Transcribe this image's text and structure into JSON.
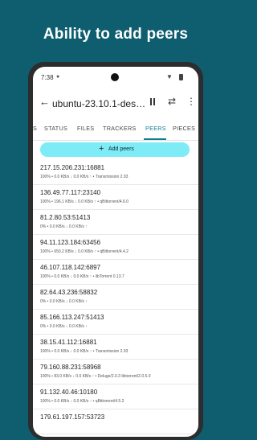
{
  "headline": "Ability to add peers",
  "status_bar": {
    "time": "7:38",
    "wifi_icon": "wifi-icon",
    "battery_icon": "battery-icon"
  },
  "toolbar": {
    "back_icon": "arrow-back-icon",
    "title": "ubuntu-23.10.1-des…",
    "pause_icon": "pause-icon",
    "sync_icon": "sync-icon",
    "more_icon": "more-vert-icon"
  },
  "tabs": [
    {
      "label": "S",
      "active": false
    },
    {
      "label": "STATUS",
      "active": false
    },
    {
      "label": "FILES",
      "active": false
    },
    {
      "label": "TRACKERS",
      "active": false
    },
    {
      "label": "PEERS",
      "active": true
    },
    {
      "label": "PIECES",
      "active": false
    }
  ],
  "add_button": {
    "label": "Add peers",
    "icon": "plus-icon"
  },
  "peers": [
    {
      "address": "217.15.206.231:16881",
      "progress": "100%",
      "down": "0.0 KB/s",
      "up": "0.0 KB/s",
      "client": "Transmission 2.93"
    },
    {
      "address": "136.49.77.117:23140",
      "progress": "100%",
      "down": "196.1 KB/s",
      "up": "0.0 KB/s",
      "client": "qBittorrent/4.6.0"
    },
    {
      "address": "81.2.80.53:51413",
      "progress": "0%",
      "down": "0.0 KB/s",
      "up": "0.0 KB/s",
      "client": ""
    },
    {
      "address": "94.11.123.184:63456",
      "progress": "100%",
      "down": "650.2 KB/s",
      "up": "0.0 KB/s",
      "client": "qBittorrent/4.4.2"
    },
    {
      "address": "46.107.118.142:6897",
      "progress": "100%",
      "down": "0.0 KB/s",
      "up": "0.0 KB/s",
      "client": "libTorrent 0.13.7"
    },
    {
      "address": "82.64.43.236:58832",
      "progress": "0%",
      "down": "0.0 KB/s",
      "up": "0.0 KB/s",
      "client": ""
    },
    {
      "address": "85.166.113.247:51413",
      "progress": "0%",
      "down": "0.0 KB/s",
      "up": "0.0 KB/s",
      "client": ""
    },
    {
      "address": "38.15.41.112:16881",
      "progress": "100%",
      "down": "0.0 KB/s",
      "up": "0.0 KB/s",
      "client": "Transmission 2.93"
    },
    {
      "address": "79.160.88.231:58968",
      "progress": "100%",
      "down": "83.0 KB/s",
      "up": "0.0 KB/s",
      "client": "Deluge/2.0.3 libtorrent/2.0.5.0"
    },
    {
      "address": "91.132.40.46:10180",
      "progress": "100%",
      "down": "0.0 KB/s",
      "up": "0.0 KB/s",
      "client": "qBittorrent/4.5.2"
    },
    {
      "address": "179.61.197.157:53723",
      "progress": "",
      "down": "",
      "up": "",
      "client": ""
    }
  ],
  "colors": {
    "background": "#0e5e70",
    "accent": "#0e7e8e",
    "button": "#7eecf6"
  }
}
